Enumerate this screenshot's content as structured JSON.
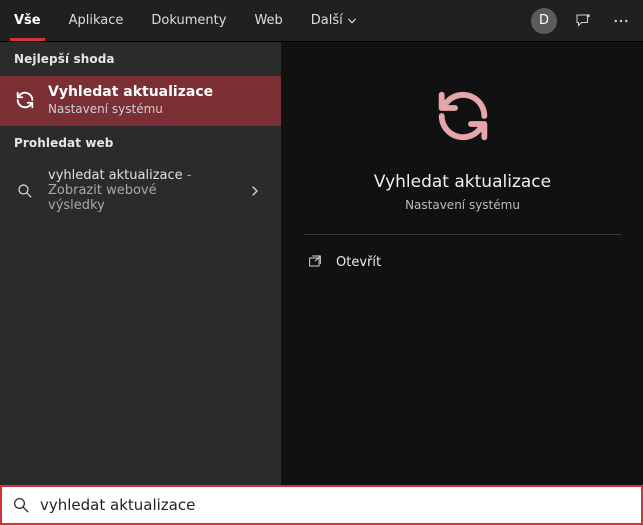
{
  "tabs": {
    "items": [
      {
        "label": "Vše",
        "active": true
      },
      {
        "label": "Aplikace",
        "active": false
      },
      {
        "label": "Dokumenty",
        "active": false
      },
      {
        "label": "Web",
        "active": false
      }
    ],
    "more_label": "Další"
  },
  "user": {
    "initial": "D"
  },
  "left": {
    "best_match_header": "Nejlepší shoda",
    "best_match": {
      "title": "Vyhledat aktualizace",
      "subtitle": "Nastavení systému"
    },
    "search_web_header": "Prohledat web",
    "web_result": {
      "title": "vyhledat aktualizace",
      "suffix_sep": " - ",
      "suffix_line1": "Zobrazit webové",
      "suffix_line2": "výsledky"
    }
  },
  "preview": {
    "title": "Vyhledat aktualizace",
    "subtitle": "Nastavení systému",
    "open_label": "Otevřít"
  },
  "search": {
    "value": "vyhledat aktualizace",
    "placeholder": ""
  },
  "colors": {
    "accent": "#d13438",
    "selection": "#7a2f35",
    "preview_icon": "#e6a6a9"
  }
}
